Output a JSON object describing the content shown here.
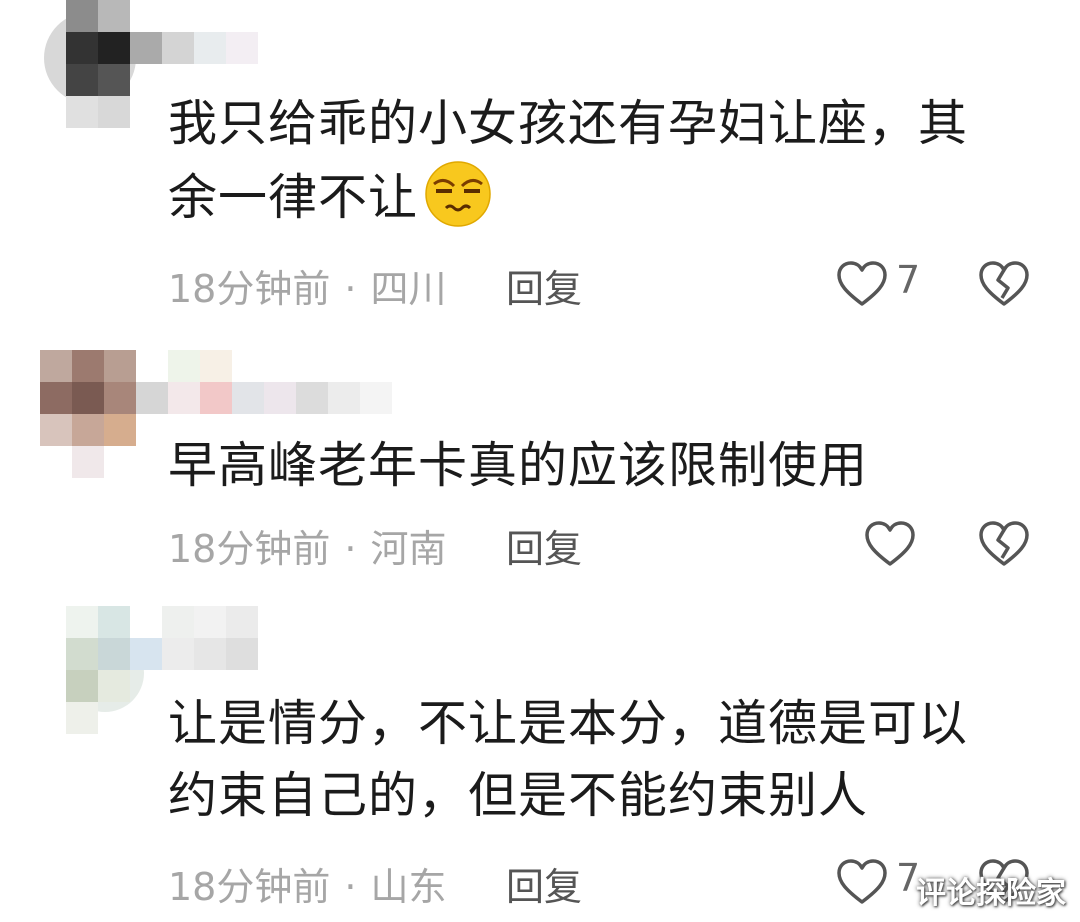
{
  "comments": [
    {
      "text_line1": "我只给乖的小女孩还有孕妇让座，其",
      "text_line2": "余一律不让",
      "time": "18分钟前",
      "sep": "·",
      "location": "四川",
      "reply_label": "回复",
      "likes": "7"
    },
    {
      "text_line1": "早高峰老年卡真的应该限制使用",
      "time": "18分钟前",
      "sep": "·",
      "location": "河南",
      "reply_label": "回复"
    },
    {
      "text_line1": "让是情分，不让是本分，道德是可以",
      "text_line2": "约束自己的，但是不能约束别人",
      "time": "18分钟前",
      "sep": "·",
      "location": "山东",
      "reply_label": "回复",
      "likes": "7"
    }
  ],
  "watermark": "评论探险家",
  "colors": {
    "text": "#1b1b1b",
    "meta": "#a6a6a6",
    "reply": "#555555",
    "icon": "#555555"
  },
  "icons": [
    "heart-outline-icon",
    "broken-heart-icon",
    "squint-face-emoji"
  ]
}
